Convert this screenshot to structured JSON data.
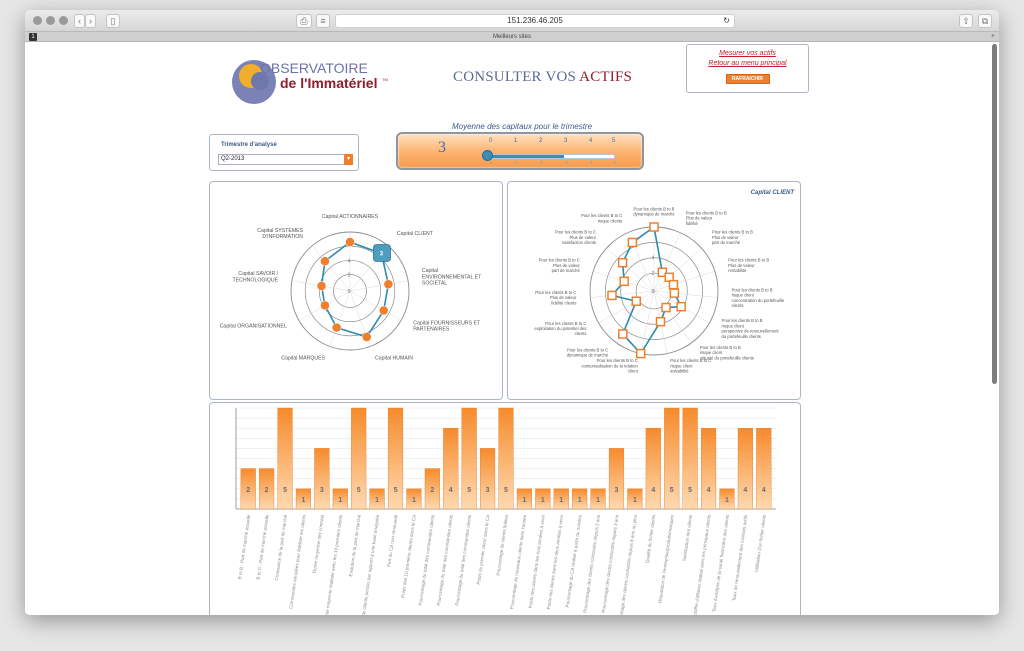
{
  "browser": {
    "url": "151.236.46.205",
    "tab_title": "Meilleurs sites",
    "tab_number": "1",
    "tab_plus": "+"
  },
  "logo": {
    "line1": "OBSERVATOIRE",
    "line2": "de l'Immatériel",
    "tm": "TM"
  },
  "title": {
    "part1": "CONSULTER VOS",
    "part2": "ACTIFS"
  },
  "links": {
    "measure": "Mesurer vos actifs",
    "back": "Retour au menu principal",
    "refresh": "RAFRAICHIR"
  },
  "trimestre": {
    "label": "Trimestre d'analyse",
    "value": "Q2-2013",
    "arrow": "▾"
  },
  "gauge": {
    "caption": "Moyenne des capitaux pour le trimestre",
    "value": "3",
    "scale": [
      "0",
      "1",
      "2",
      "3",
      "4",
      "5"
    ],
    "min": 0,
    "max": 5,
    "level": 0
  },
  "colors": {
    "orange": "#f07f2b",
    "blue_line": "#2a8cb0",
    "navy_text": "#3e5a8a",
    "title_red": "#8f1d2b",
    "title_blue": "#5b6a93"
  },
  "radar_left": {
    "ring_labels": [
      "0",
      "2",
      "4"
    ],
    "labels": [
      {
        "text": "Capital ACTIONNAIRES",
        "lines": [
          "Capital ACTIONNAIRES"
        ]
      },
      {
        "text": "Capital CLIENT",
        "lines": [
          "Capital CLIENT"
        ]
      },
      {
        "text": "Capital ENVIRONNEMENTAL ET SOCIETAL",
        "lines": [
          "Capital",
          "ENVIRONNEMENTAL ET",
          "SOCIETAL"
        ]
      },
      {
        "text": "Capital FOURNISSEURS ET PARTENAIRES",
        "lines": [
          "Capital FOURNISSEURS ET",
          "PARTENAIRES"
        ]
      },
      {
        "text": "Capital HUMAIN",
        "lines": [
          "Capital HUMAIN"
        ]
      },
      {
        "text": "Capital MARQUES",
        "lines": [
          "Capital MARQUES"
        ]
      },
      {
        "text": "Capital ORGANISATIONNEL",
        "lines": [
          "Capital ORGANISATIONNEL"
        ]
      },
      {
        "text": "Capital SAVOIR / TECHNOLOGIQUE",
        "lines": [
          "Capital SAVOIR /",
          "TECHNOLOGIQUE"
        ]
      },
      {
        "text": "Capital SYSTEMES D'INFORMATION",
        "lines": [
          "Capital SYSTEMES",
          "D'INFORMATION"
        ]
      }
    ],
    "values": [
      4,
      4,
      3,
      3,
      4,
      3,
      2,
      2,
      3
    ],
    "highlight_label": "3"
  },
  "radar_right": {
    "title": "Capital CLIENT",
    "ring_labels": [
      "0",
      "2",
      "4"
    ],
    "labels": [
      {
        "lines": [
          "Pour les clients B to B",
          "dynamique de marché"
        ]
      },
      {
        "lines": [
          "Pour les clients B to B",
          "Plus de valeur",
          "fidélité"
        ]
      },
      {
        "lines": [
          "Pour les clients B to B",
          "Plus de valeur",
          "part de marché"
        ]
      },
      {
        "lines": [
          "Pour les clients B to B",
          "Plus de valeur",
          "rentabilité"
        ]
      },
      {
        "lines": [
          "Pour les clients B to B",
          "risque client",
          "concentration du portefeuille",
          "clients"
        ]
      },
      {
        "lines": [
          "Pour les clients B to B",
          "risque client",
          "perspective de renouvellement",
          "du portefeuille clients"
        ]
      },
      {
        "lines": [
          "Pour les clients B to B",
          "risque client",
          "vétusté du portefeuille clients"
        ]
      },
      {
        "lines": [
          "Pour les clients B to C",
          "risque client",
          "solvabilité"
        ]
      },
      {
        "lines": [
          "Pour les clients B to C",
          "contextualisation de la relation",
          "client"
        ]
      },
      {
        "lines": [
          "Pour les clients B to C",
          "dynamique de marché"
        ]
      },
      {
        "lines": [
          "Pour les clients B to C",
          "exploitation du potentiel des",
          "clients"
        ]
      },
      {
        "lines": [
          "Pour les clients B to C",
          "Plus de valeur",
          "fidélité clients"
        ]
      },
      {
        "lines": [
          "Pour les clients B to C",
          "Plus de valeur",
          "part de marché"
        ]
      },
      {
        "lines": [
          "Pour les clients B to C",
          "Plus de valeur",
          "satisfaction clients"
        ]
      },
      {
        "lines": [
          "Pour les clients B to C",
          "risque clients"
        ]
      }
    ],
    "values": [
      5,
      1,
      1,
      1,
      1,
      2,
      1,
      2,
      5,
      4,
      1,
      3,
      2,
      3,
      4
    ]
  },
  "chart_data": {
    "type": "bar",
    "ylim": [
      0,
      5
    ],
    "values": [
      2,
      2,
      5,
      1,
      3,
      1,
      5,
      1,
      5,
      1,
      2,
      4,
      5,
      3,
      5,
      1,
      1,
      1,
      1,
      1,
      3,
      1,
      4,
      5,
      5,
      4,
      1,
      4,
      4
    ],
    "categories": [
      "B to B - Part de marché actuelle",
      "B to C - Part de marché actuelle",
      "Croissance de la part de marché",
      "Commandes annulées pour fidéliser les clients",
      "Durée moyenne des contrats",
      "Durée moyenne réalisée avec les 10 premiers clients",
      "Evolution de la part de marché",
      "Nombre de clients perdus par rapport à une base analysée",
      "Part du CA non renouvelé",
      "Poids des 10 premiers clients dans le CA",
      "Pourcentage du total des commandes clients",
      "Pourcentage du total des commandes clients",
      "Pourcentage du total des commandes clients",
      "Poids du premier client dans le CA",
      "Pourcentage de clients fidèles",
      "Pourcentage de nouveaux clients dans l'année",
      "Poids des clients dans les trois années à venir",
      "Poids des clients dans les deux années à venir",
      "Pourcentage du CA réalisé à partir du nombre",
      "Pourcentage des clients contractés depuis 5 ans",
      "Pourcentage des clients contractés depuis 3 ans",
      "Pourcentage des clients contractés depuis 8 ans ou plus",
      "Qualité du fichier clients",
      "Réputation de l'entreprise/produits/marques",
      "Satisfaction des clients",
      "Taux de chiffre d'affaires réalisé avec les principaux clients",
      "Taux d'analyse de la santé financière des clients",
      "Taux de renouvellement des contrats actifs",
      "Utilisation d'un fichier clients"
    ]
  }
}
